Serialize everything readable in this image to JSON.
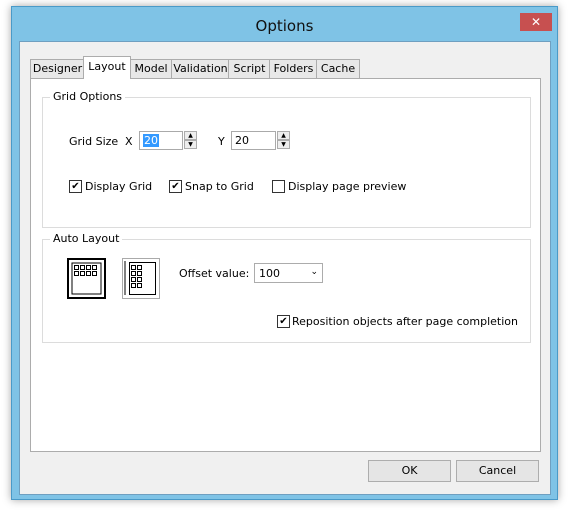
{
  "window": {
    "title": "Options",
    "close_glyph": "✕"
  },
  "tabs": [
    {
      "label": "Designer"
    },
    {
      "label": "Layout"
    },
    {
      "label": "Model"
    },
    {
      "label": "Validation"
    },
    {
      "label": "Script"
    },
    {
      "label": "Folders"
    },
    {
      "label": "Cache"
    }
  ],
  "grid_options": {
    "title": "Grid Options",
    "grid_size_label": "Grid Size",
    "x_label": "X",
    "x_value": "20",
    "y_label": "Y",
    "y_value": "20",
    "display_grid": {
      "label": "Display Grid",
      "checked": true
    },
    "snap_to_grid": {
      "label": "Snap to Grid",
      "checked": true
    },
    "display_page_preview": {
      "label": "Display page preview",
      "checked": false
    }
  },
  "auto_layout": {
    "title": "Auto Layout",
    "offset_label": "Offset value:",
    "offset_value": "100",
    "reposition": {
      "label": "Reposition objects after page completion",
      "checked": true
    }
  },
  "buttons": {
    "ok": "OK",
    "cancel": "Cancel"
  },
  "check_glyph": "✔"
}
